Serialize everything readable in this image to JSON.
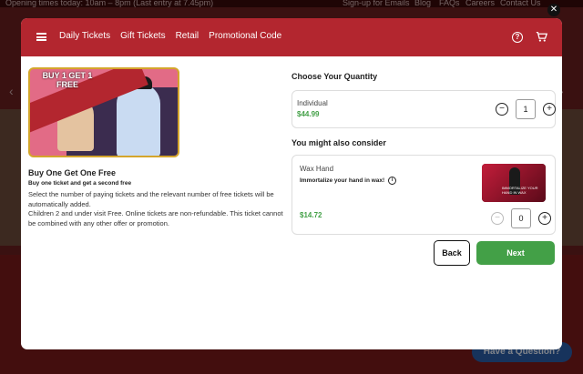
{
  "background": {
    "topbar_left": "Opening times today: 10am – 8pm (Last entry at 7.45pm)",
    "topbar_links": [
      "Sign-up for Emails",
      "Blog",
      "FAQs",
      "Careers",
      "Contact Us"
    ],
    "help_bubble": "Have a Question?"
  },
  "header": {
    "nav": [
      "Daily Tickets",
      "Gift Tickets",
      "Retail",
      "Promotional Code"
    ],
    "accent": "#b3262f"
  },
  "product": {
    "badge_line1": "BUY 1 GET 1",
    "badge_line2": "FREE",
    "title": "Buy One Get One Free",
    "subtitle": "Buy one ticket and get a second free",
    "description": [
      "Select the number of paying tickets and the relevant number of free tickets will be automatically added.",
      "Children 2 and under visit Free. Online tickets are non-refundable. This ticket cannot be combined with any other offer or promotion."
    ]
  },
  "quantity": {
    "heading": "Choose Your Quantity",
    "label": "Individual",
    "price": "$44.99",
    "value": "1"
  },
  "upsell": {
    "heading": "You might also consider",
    "name": "Wax Hand",
    "tagline": "Immortalize your hand in wax!",
    "price": "$14.72",
    "value": "0",
    "thumb_text": "IMMORTALIZE YOUR HAND IN WAX"
  },
  "actions": {
    "back": "Back",
    "next": "Next"
  },
  "colors": {
    "price_green": "#43a047",
    "next_green": "#43a047"
  }
}
